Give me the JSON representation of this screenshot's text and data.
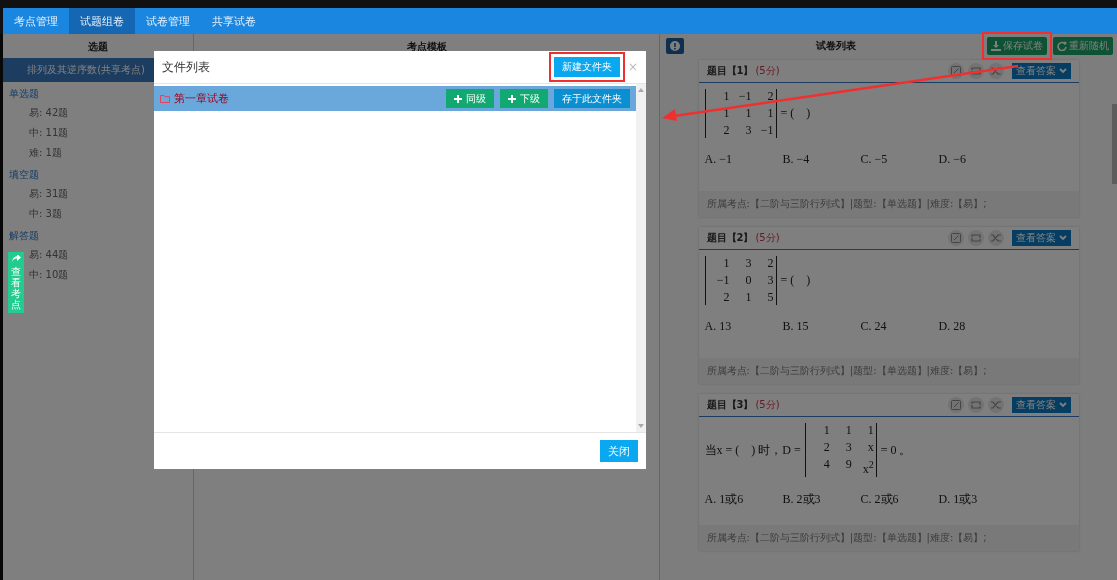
{
  "tabs": [
    {
      "label": "考点管理",
      "selected": false
    },
    {
      "label": "试题组卷",
      "selected": true
    },
    {
      "label": "试卷管理",
      "selected": false
    },
    {
      "label": "共享试卷",
      "selected": false
    }
  ],
  "sidebar": {
    "title": "选题",
    "topic": {
      "label": "排列及其逆序数(共享考点)",
      "selected": true
    },
    "groups": [
      {
        "label": "单选题",
        "items": [
          "易: 42题",
          "中: 11题",
          "难: 1题"
        ]
      },
      {
        "label": "填空题",
        "items": [
          "易: 31题",
          "中: 3题"
        ]
      },
      {
        "label": "解答题",
        "items": [
          "易: 44题",
          "中: 10题"
        ]
      }
    ]
  },
  "floating_tab": {
    "label": "查看考点"
  },
  "middle_panel": {
    "title": "考点模板"
  },
  "paper_panel": {
    "title": "试卷列表",
    "buttons": [
      {
        "kind": "save",
        "label": "保存试卷",
        "highlighted": true
      },
      {
        "kind": "refresh",
        "label": "重新随机",
        "highlighted": false
      }
    ],
    "questions": [
      {
        "number": "题目【1】",
        "score": "(5分)",
        "stem": {
          "matrix": [
            [
              "1",
              "−1",
              "2"
            ],
            [
              "1",
              "1",
              "1"
            ],
            [
              "2",
              "3",
              "−1"
            ]
          ],
          "suffix": "= (　)"
        },
        "options": [
          "A. −1",
          "B. −4",
          "C. −5",
          "D. −6"
        ],
        "answer_button": "查看答案",
        "meta": "所属考点:【二阶与三阶行列式】|题型:【单选题】|难度:【易】;"
      },
      {
        "number": "题目【2】",
        "score": "(5分)",
        "stem": {
          "matrix": [
            [
              "1",
              "3",
              "2"
            ],
            [
              "−1",
              "0",
              "3"
            ],
            [
              "2",
              "1",
              "5"
            ]
          ],
          "suffix": "= (　)"
        },
        "options": [
          "A. 13",
          "B. 15",
          "C. 24",
          "D. 28"
        ],
        "answer_button": "查看答案",
        "meta": "所属考点:【二阶与三阶行列式】|题型:【单选题】|难度:【易】;"
      },
      {
        "number": "题目【3】",
        "score": "(5分)",
        "stem": {
          "prefix": "当x = (　) 时，D =",
          "matrix": [
            [
              "1",
              "1",
              "1"
            ],
            [
              "2",
              "3",
              "x"
            ],
            [
              "4",
              "9",
              "x$^{2}$"
            ]
          ],
          "suffix": "= 0 。"
        },
        "options": [
          "A. 1或6",
          "B. 2或3",
          "C. 2或6",
          "D. 1或3"
        ],
        "answer_button": "查看答案",
        "meta": "所属考点:【二阶与三阶行列式】|题型:【单选题】|难度:【易】;"
      }
    ]
  },
  "dialog": {
    "title": "文件列表",
    "close": "×",
    "new_folder_button": {
      "label": "新建文件夹",
      "highlighted": true
    },
    "folders": [
      {
        "name": "第一章试卷",
        "selected": true,
        "actions": [
          {
            "kind": "add",
            "label": "同级"
          },
          {
            "kind": "add",
            "label": "下级"
          },
          {
            "kind": "plain",
            "label": "存于此文件夹"
          }
        ]
      }
    ],
    "footer_button": "关闭"
  }
}
